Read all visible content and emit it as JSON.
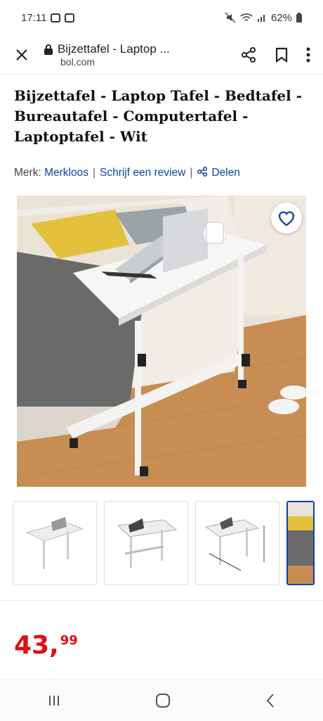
{
  "status_bar": {
    "time": "17:11",
    "battery": "62%"
  },
  "browser": {
    "page_title": "Bijzettafel - Laptop ...",
    "domain": "bol.com"
  },
  "product": {
    "title": "Bijzettafel - Laptop Tafel - Bedtafel - Bureautafel - Computertafel - Laptoptafel - Wit",
    "brand_label": "Merk:",
    "brand": "Merkloos",
    "review_link": "Schrijf een review",
    "share_link": "Delen"
  },
  "price": {
    "main": "43,",
    "cents": "99"
  },
  "icons": {
    "close": "close-icon",
    "lock": "lock-icon",
    "share": "share-icon",
    "bookmark": "bookmark-icon",
    "more": "more-vertical-icon",
    "heart": "heart-icon",
    "recents": "recents-icon",
    "home": "home-icon",
    "back": "back-icon"
  },
  "colors": {
    "price": "#e00e0e",
    "link": "#0b43a8"
  }
}
